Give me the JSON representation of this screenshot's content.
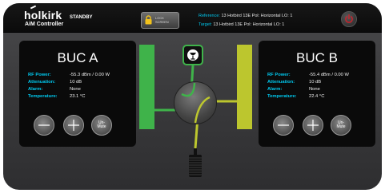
{
  "header": {
    "brand": "holkirk",
    "subtitle": "AiM Controller",
    "status": "STANDBY",
    "lock_button": {
      "line1": "LOCK",
      "line2": "SCREEN"
    },
    "reference": {
      "label": "Reference:",
      "value": "13 Hotbird 13E Pol: Horizontal LO: 1"
    },
    "target": {
      "label": "Target:",
      "value": "13 Hotbird 13E Pol: Horizontal LO: 1"
    }
  },
  "panels": [
    {
      "title": "BUC A",
      "stats": [
        {
          "label": "RF Power:",
          "value": "-55.3 dBm / 0.00 W"
        },
        {
          "label": "Attenuation:",
          "value": "10 dB"
        },
        {
          "label": "Alarm:",
          "value": "None"
        },
        {
          "label": "Temperature:",
          "value": "23.1 °C"
        }
      ],
      "unmute_label": {
        "line1": "Un-",
        "line2": "Mute"
      }
    },
    {
      "title": "BUC B",
      "stats": [
        {
          "label": "RF Power:",
          "value": "-55.4 dBm / 0.00 W"
        },
        {
          "label": "Attenuation:",
          "value": "10 dB"
        },
        {
          "label": "Alarm:",
          "value": "None"
        },
        {
          "label": "Temperature:",
          "value": "22.4 °C"
        }
      ],
      "unmute_label": {
        "line1": "Un-",
        "line2": "Mute"
      }
    }
  ],
  "colors": {
    "accent_cyan": "#00c8ee",
    "path_a_green": "#3fb34a",
    "path_b_yellow": "#bcc62e",
    "lock_yellow": "#f2c21b",
    "power_red": "#d0202a"
  },
  "icons": {
    "lock": "lock-icon",
    "power": "power-icon",
    "satellite": "satellite-dish-icon",
    "feed": "feed-horn-icon"
  }
}
